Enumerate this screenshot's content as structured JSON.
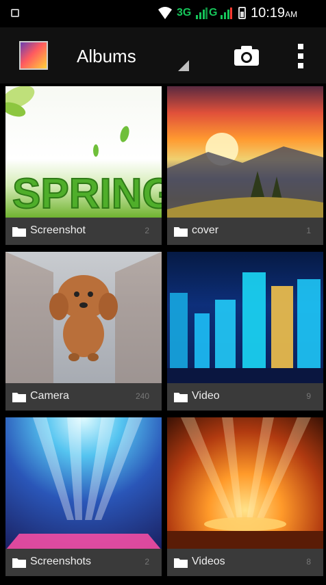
{
  "status_bar": {
    "network_3g": "3G",
    "network_g": "G",
    "time": "10:19",
    "ampm": "AM"
  },
  "action_bar": {
    "title": "Albums",
    "camera_icon": "camera-icon",
    "overflow_icon": "overflow-menu-icon"
  },
  "albums": [
    {
      "name": "Screenshot",
      "count": "2"
    },
    {
      "name": "cover",
      "count": "1"
    },
    {
      "name": "Camera",
      "count": "240"
    },
    {
      "name": "Video",
      "count": "9"
    },
    {
      "name": "Screenshots",
      "count": "2"
    },
    {
      "name": "Videos",
      "count": "8"
    }
  ],
  "thumbnail_text": {
    "spring": "SPRING"
  },
  "colors": {
    "status_green": "#16c55a",
    "label_bg": "#3a3a3a",
    "actionbar_bg": "#111111"
  }
}
